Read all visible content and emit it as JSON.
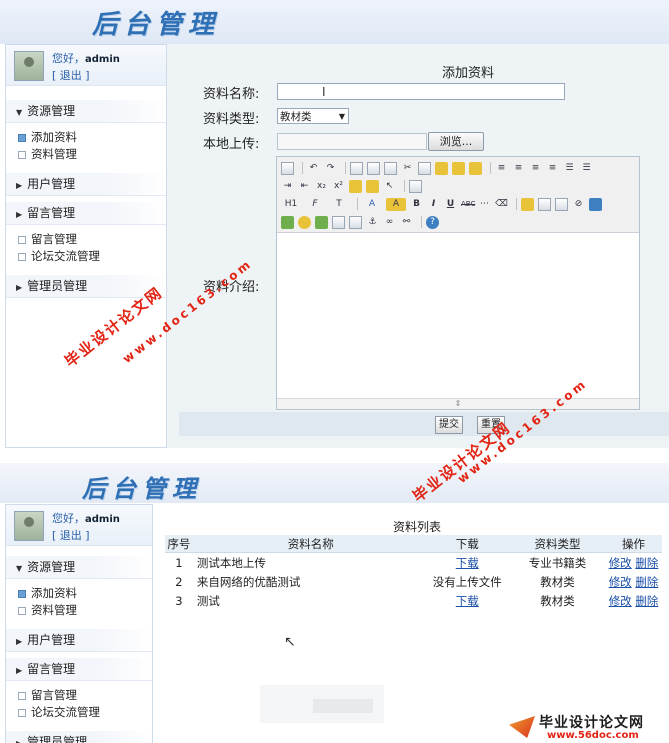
{
  "app": {
    "logo_text": "后台管理"
  },
  "user": {
    "greeting": "您好，",
    "name": "admin",
    "logout": "[ 退出 ]"
  },
  "sidebar": {
    "groups": [
      {
        "label": "资源管理",
        "items": [
          "添加资料",
          "资料管理"
        ]
      },
      {
        "label": "用户管理",
        "items": []
      },
      {
        "label": "留言管理",
        "items": [
          "留言管理",
          "论坛交流管理"
        ]
      },
      {
        "label": "管理员管理",
        "items": []
      }
    ]
  },
  "form": {
    "title": "添加资料",
    "name_label": "资料名称:",
    "name_value": "",
    "type_label": "资料类型:",
    "type_value": "教材类",
    "upload_label": "本地上传:",
    "browse_label": "浏览...",
    "intro_label": "资料介绍:",
    "submit_label": "提交",
    "reset_label": "重置"
  },
  "editor": {
    "row2": {
      "h1": "H1",
      "font": "F",
      "size": "T",
      "color": "A",
      "bold": "B",
      "italic": "I",
      "underline": "U",
      "strike": "ABC"
    },
    "sup": "x²",
    "sub": "x₂"
  },
  "list": {
    "title": "资料列表",
    "columns": [
      "序号",
      "资料名称",
      "下载",
      "资料类型",
      "操作"
    ],
    "rows": [
      {
        "no": "1",
        "name": "测试本地上传",
        "download": "下载",
        "download_is_link": true,
        "type": "专业书籍类",
        "edit": "修改",
        "delete": "删除"
      },
      {
        "no": "2",
        "name": "来自网络的优酷测试",
        "download": "没有上传文件",
        "download_is_link": false,
        "type": "教材类",
        "edit": "修改",
        "delete": "删除"
      },
      {
        "no": "3",
        "name": "测试",
        "download": "下载",
        "download_is_link": true,
        "type": "教材类",
        "edit": "修改",
        "delete": "删除"
      }
    ]
  },
  "watermark": {
    "cn": "毕业设计论文网",
    "url": "www.doc163.com",
    "site_name": "毕业设计论文网",
    "site_url": "www.56doc.com"
  },
  "colors": {
    "accent": "#2f6fb4",
    "link": "#1b4fa8",
    "watermark": "#e22414"
  }
}
